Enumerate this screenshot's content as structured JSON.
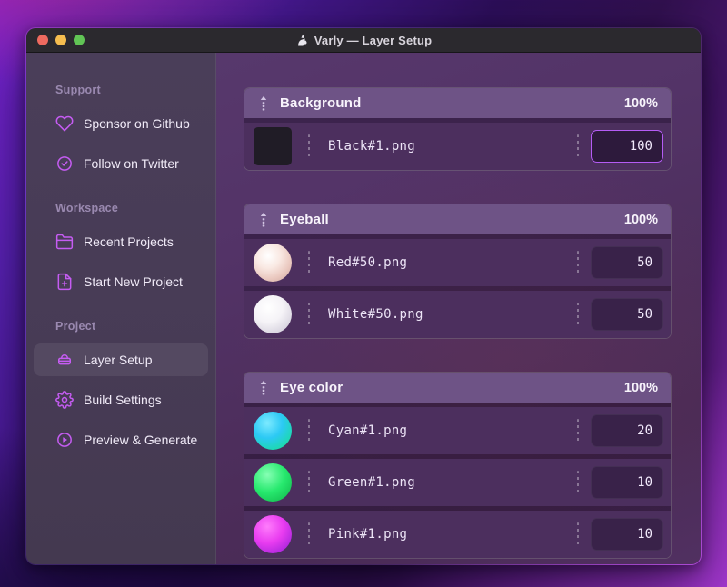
{
  "window": {
    "title": "Varly — Layer Setup",
    "app_icon": "unicorn-icon",
    "traffic_lights": [
      "close",
      "minimize",
      "zoom"
    ]
  },
  "sidebar": {
    "sections": [
      {
        "label": "Support",
        "items": [
          {
            "icon": "heart-icon",
            "label": "Sponsor on Github"
          },
          {
            "icon": "verified-check-icon",
            "label": "Follow on Twitter"
          }
        ]
      },
      {
        "label": "Workspace",
        "items": [
          {
            "icon": "folder-icon",
            "label": "Recent Projects"
          },
          {
            "icon": "file-plus-icon",
            "label": "Start New Project"
          }
        ]
      },
      {
        "label": "Project",
        "items": [
          {
            "icon": "layer-basket-icon",
            "label": "Layer Setup",
            "active": true
          },
          {
            "icon": "gear-icon",
            "label": "Build Settings"
          },
          {
            "icon": "play-circle-icon",
            "label": "Preview & Generate"
          }
        ]
      }
    ]
  },
  "layers": {
    "drag_icon": "drag-handle-icon",
    "groups": [
      {
        "name": "Background",
        "opacity": "100%",
        "rows": [
          {
            "file": "Black#1.png",
            "weight": "100",
            "swatch": "black",
            "focused": true
          }
        ]
      },
      {
        "name": "Eyeball",
        "opacity": "100%",
        "rows": [
          {
            "file": "Red#50.png",
            "weight": "50",
            "swatch": "red"
          },
          {
            "file": "White#50.png",
            "weight": "50",
            "swatch": "white"
          }
        ]
      },
      {
        "name": "Eye color",
        "opacity": "100%",
        "rows": [
          {
            "file": "Cyan#1.png",
            "weight": "20",
            "swatch": "cyan"
          },
          {
            "file": "Green#1.png",
            "weight": "10",
            "swatch": "green"
          },
          {
            "file": "Pink#1.png",
            "weight": "10",
            "swatch": "pink"
          }
        ]
      }
    ]
  },
  "colors": {
    "accent_icon": "#c55cf2",
    "focus_border": "#b55cf5",
    "group_header_bg": "#6e5386",
    "row_bg": "#4c2f5e",
    "sidebar_bg": "#473b55",
    "titlebar_bg": "#2b292e",
    "traffic_red": "#ee6a5f",
    "traffic_yellow": "#f5bd4f",
    "traffic_green": "#61c455"
  }
}
